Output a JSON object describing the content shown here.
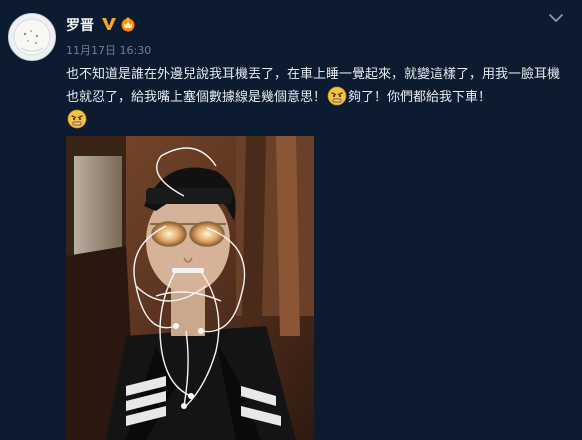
{
  "post": {
    "author": "罗晋",
    "timestamp": "11月17日 16:30",
    "text_part1": "也不知道是誰在外邊兒說我耳機丟了，在車上睡一覺起來，就變這樣了，用我一臉耳機也就忍了，給我嘴上塞個數據線是幾個意思！",
    "text_part2": "夠了！你們都給我下車！",
    "emoji_name": "angry-face-icon",
    "photo_description_icon": "selfie-with-earphones-photo"
  },
  "icons": {
    "verified": "verified-v-icon",
    "vip": "vip-crown-icon",
    "menu": "chevron-down-icon"
  },
  "colors": {
    "background": "#0c1b30",
    "verified_gold": "#f5a623",
    "vip_orange": "#ff8a00",
    "timestamp": "#6f7f95"
  }
}
